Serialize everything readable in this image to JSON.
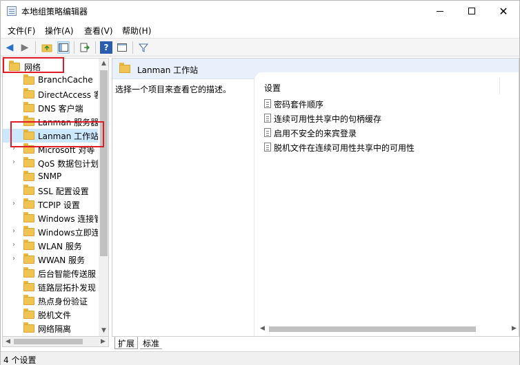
{
  "window": {
    "title": "本地组策略编辑器"
  },
  "menu": [
    "文件(F)",
    "操作(A)",
    "查看(V)",
    "帮助(H)"
  ],
  "tree": {
    "root": "网络",
    "items": [
      {
        "label": "BranchCache",
        "expandable": false
      },
      {
        "label": "DirectAccess 客",
        "expandable": false
      },
      {
        "label": "DNS 客户端",
        "expandable": false
      },
      {
        "label": "Lanman 服务器",
        "expandable": false
      },
      {
        "label": "Lanman 工作站",
        "expandable": false,
        "selected": true
      },
      {
        "label": "Microsoft 对等",
        "expandable": true
      },
      {
        "label": "QoS 数据包计划",
        "expandable": true
      },
      {
        "label": "SNMP",
        "expandable": false
      },
      {
        "label": "SSL 配置设置",
        "expandable": false
      },
      {
        "label": "TCPIP 设置",
        "expandable": true
      },
      {
        "label": "Windows 连接管",
        "expandable": false
      },
      {
        "label": "Windows立即连",
        "expandable": true
      },
      {
        "label": "WLAN 服务",
        "expandable": true
      },
      {
        "label": "WWAN 服务",
        "expandable": true
      },
      {
        "label": "后台智能传送服",
        "expandable": false
      },
      {
        "label": "链路层拓扑发现",
        "expandable": false
      },
      {
        "label": "热点身份验证",
        "expandable": false
      },
      {
        "label": "脱机文件",
        "expandable": false
      },
      {
        "label": "网络隔离",
        "expandable": false
      }
    ]
  },
  "right_pane": {
    "header": "Lanman 工作站",
    "description": "选择一个项目来查看它的描述。",
    "column_header": "设置",
    "settings": [
      "密码套件顺序",
      "连续可用性共享中的句柄缓存",
      "启用不安全的来宾登录",
      "脱机文件在连续可用性共享中的可用性"
    ]
  },
  "tabs": [
    "扩展",
    "标准"
  ],
  "status": "4 个设置",
  "colors": {
    "annotation": "#e01b24",
    "folder": "#f0c453",
    "header_bg": "#e8f1fb"
  }
}
